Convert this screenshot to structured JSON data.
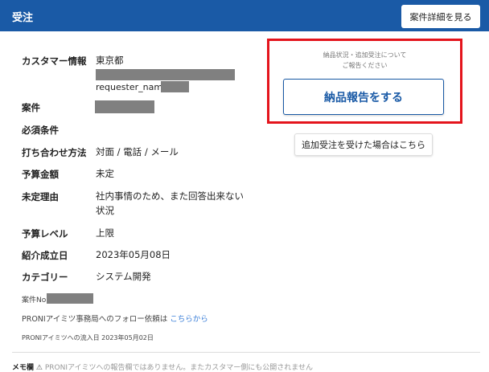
{
  "header": {
    "title": "受注",
    "detail_button": "案件詳細を見る"
  },
  "fields": [
    {
      "label": "カスタマー情報",
      "value": "東京都",
      "value2": "requester_name_"
    },
    {
      "label": "案件"
    },
    {
      "label": "必須条件",
      "value": ""
    },
    {
      "label": "打ち合わせ方法",
      "value": "対面 / 電話 / メール"
    },
    {
      "label": "予算金額",
      "value": "未定"
    },
    {
      "label": "未定理由",
      "value": "社内事情のため、また回答出来ない",
      "value2": "状況"
    },
    {
      "label": "予算レベル",
      "value": "上限"
    },
    {
      "label": "紹介成立日",
      "value": "2023年05月08日"
    },
    {
      "label": "カテゴリー",
      "value": "システム開発"
    }
  ],
  "footer": {
    "case_no": "案件No.",
    "follow_text": "PRONIアイミツ事務局へのフォロー依頼は",
    "follow_link": "こちらから",
    "inflow": "PRONIアイミツへの流入日 2023年05月02日"
  },
  "memo": {
    "label": "メモ欄",
    "note": "PRONIアイミツへの報告欄ではありません。またカスタマー側にも公開されません"
  },
  "report": {
    "note1": "納品状況・追加受注について",
    "note2": "ご報告ください",
    "button": "納品報告をする",
    "additional_button": "追加受注を受けた場合はこちら"
  }
}
